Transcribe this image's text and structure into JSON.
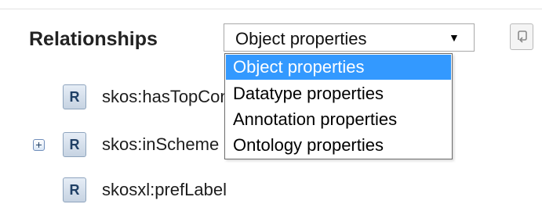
{
  "header": {
    "title": "Relationships",
    "select": {
      "value": "Object properties",
      "options": [
        {
          "label": "Object properties",
          "selected": true
        },
        {
          "label": "Datatype properties",
          "selected": false
        },
        {
          "label": "Annotation properties",
          "selected": false
        },
        {
          "label": "Ontology properties",
          "selected": false
        }
      ]
    },
    "reload_icon": "undo-arrow-icon"
  },
  "tree": {
    "badge_letter": "R",
    "items": [
      {
        "label": "skos:hasTopConcept",
        "expandable": false
      },
      {
        "label": "skos:inScheme",
        "expandable": true
      },
      {
        "label": "skosxl:prefLabel",
        "expandable": false
      }
    ]
  },
  "colors": {
    "selection": "#3399ff",
    "badge_text": "#1f3f65"
  }
}
